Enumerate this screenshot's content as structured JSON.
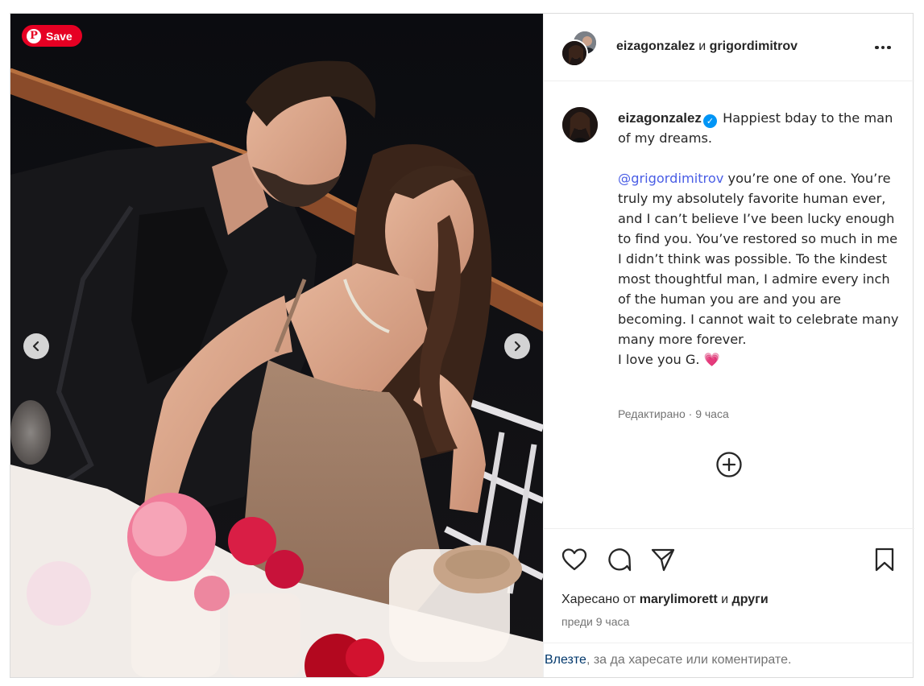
{
  "pinterest": {
    "save_label": "Save"
  },
  "header": {
    "author_1": "eizagonzalez",
    "conjunction": "и",
    "author_2": "grigordimitrov"
  },
  "caption": {
    "username": "eizagonzalez",
    "verified": true,
    "line_1": "Happiest bday to the man of my dreams.",
    "mention": "@grigordimitrov",
    "line_2": "you’re one of one. You’re truly my absolutely favorite human ever, and I can’t believe I’ve been lucky enough to find you. You’ve restored so much in me I didn’t think was possible. To the kindest most thoughtful man, I admire every inch of the human you are and you are becoming. I cannot wait to celebrate many many more forever.",
    "line_3": "I love you G.",
    "emoji": "💗",
    "meta": "Редактирано · 9 часа"
  },
  "likes": {
    "prefix": "Харесано от",
    "user": "marylimorett",
    "conjunction": "и",
    "others": "други"
  },
  "time_ago": "преди 9 часа",
  "login_prompt": {
    "link": "Влезте",
    "rest": ", за да харесате или коментирате."
  },
  "icons": {
    "prev": "chevron-left-icon",
    "next": "chevron-right-icon",
    "more": "more-options-icon",
    "like": "heart-outline-icon",
    "comment": "comment-bubble-icon",
    "share": "paper-plane-icon",
    "save": "bookmark-icon",
    "add_comment": "add-circle-icon"
  },
  "colors": {
    "pinterest_red": "#e60023",
    "verified_blue": "#0095f6",
    "mention_blue": "#4a5ee5",
    "login_link": "#00376b",
    "muted_text": "#737373"
  }
}
